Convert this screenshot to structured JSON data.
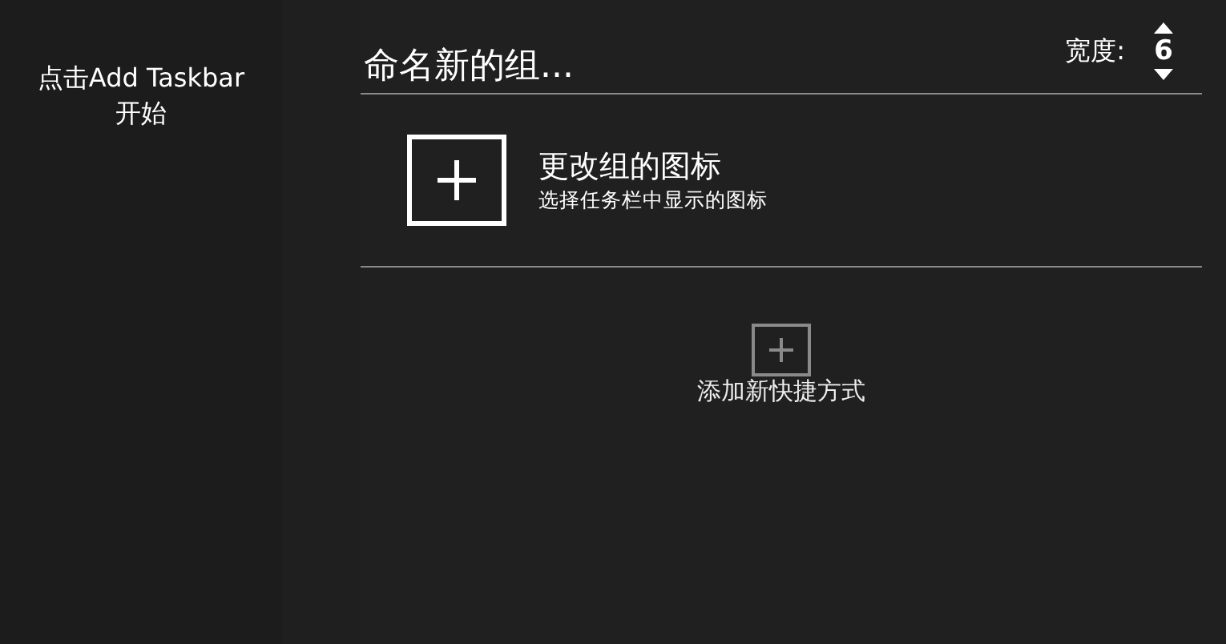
{
  "sidebar": {
    "hint_lines": [
      "点击Add Taskbar",
      "开始"
    ]
  },
  "group": {
    "name_placeholder": "命名新的组...",
    "width_label": "宽度:",
    "width_value": "6"
  },
  "icon_picker": {
    "title": "更改组的图标",
    "subtitle": "选择任务栏中显示的图标"
  },
  "add_shortcut": {
    "label": "添加新快捷方式"
  }
}
